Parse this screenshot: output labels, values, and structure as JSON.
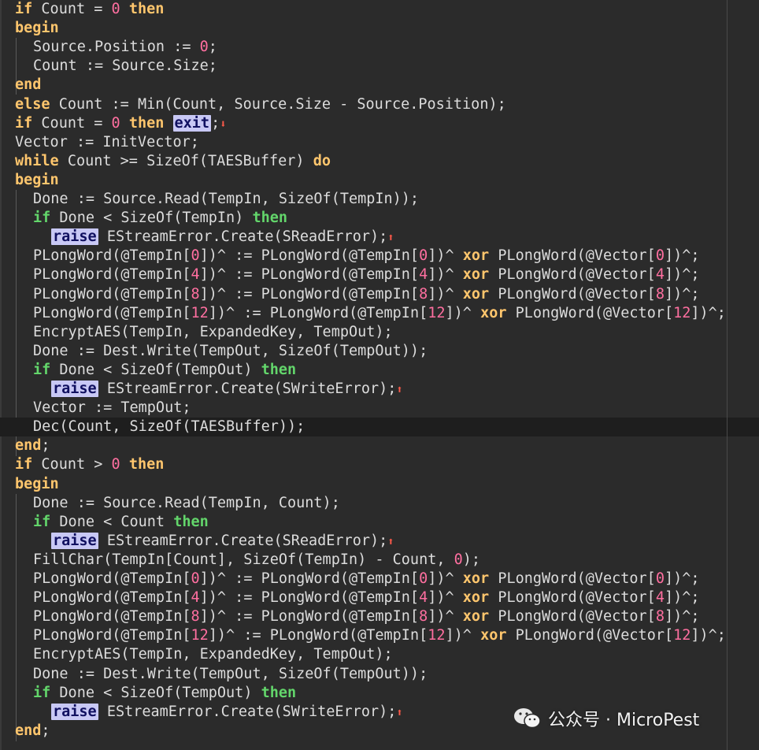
{
  "editor": {
    "current_line_index": 22,
    "lines": [
      {
        "indent": 0,
        "tokens": [
          {
            "t": "kw",
            "v": "if"
          },
          {
            "t": "p",
            "v": " Count = "
          },
          {
            "t": "num",
            "v": "0"
          },
          {
            "t": "p",
            "v": " "
          },
          {
            "t": "kw",
            "v": "then"
          }
        ]
      },
      {
        "indent": 0,
        "tokens": [
          {
            "t": "kw",
            "v": "begin"
          }
        ]
      },
      {
        "indent": 1,
        "tokens": [
          {
            "t": "p",
            "v": "Source.Position := "
          },
          {
            "t": "num",
            "v": "0"
          },
          {
            "t": "p",
            "v": ";"
          }
        ]
      },
      {
        "indent": 1,
        "tokens": [
          {
            "t": "p",
            "v": "Count := Source.Size;"
          }
        ]
      },
      {
        "indent": 0,
        "tokens": [
          {
            "t": "kw",
            "v": "end"
          }
        ]
      },
      {
        "indent": 0,
        "tokens": [
          {
            "t": "kw",
            "v": "else"
          },
          {
            "t": "p",
            "v": " Count := Min(Count, Source.Size - Source.Position);"
          }
        ]
      },
      {
        "indent": 0,
        "tokens": [
          {
            "t": "kw",
            "v": "if"
          },
          {
            "t": "p",
            "v": " Count = "
          },
          {
            "t": "num",
            "v": "0"
          },
          {
            "t": "p",
            "v": " "
          },
          {
            "t": "kw",
            "v": "then"
          },
          {
            "t": "p",
            "v": " "
          },
          {
            "t": "hl",
            "v": "exit"
          },
          {
            "t": "p",
            "v": ";"
          },
          {
            "t": "arrow",
            "v": "down"
          }
        ]
      },
      {
        "indent": 0,
        "tokens": [
          {
            "t": "p",
            "v": "Vector := InitVector;"
          }
        ]
      },
      {
        "indent": 0,
        "tokens": [
          {
            "t": "kw",
            "v": "while"
          },
          {
            "t": "p",
            "v": " Count >= SizeOf(TAESBuffer) "
          },
          {
            "t": "kw",
            "v": "do"
          }
        ]
      },
      {
        "indent": 0,
        "tokens": [
          {
            "t": "kw",
            "v": "begin"
          }
        ]
      },
      {
        "indent": 1,
        "tokens": [
          {
            "t": "p",
            "v": "Done := Source.Read(TempIn, SizeOf(TempIn));"
          }
        ]
      },
      {
        "indent": 1,
        "tokens": [
          {
            "t": "kwg",
            "v": "if"
          },
          {
            "t": "p",
            "v": " Done < SizeOf(TempIn) "
          },
          {
            "t": "kwg",
            "v": "then"
          }
        ]
      },
      {
        "indent": 2,
        "tokens": [
          {
            "t": "hl",
            "v": "raise"
          },
          {
            "t": "p",
            "v": " EStreamError.Create(SReadError);"
          },
          {
            "t": "arrow",
            "v": "up"
          }
        ]
      },
      {
        "indent": 1,
        "tokens": [
          {
            "t": "p",
            "v": "PLongWord(@TempIn["
          },
          {
            "t": "num",
            "v": "0"
          },
          {
            "t": "p",
            "v": "])^ := PLongWord(@TempIn["
          },
          {
            "t": "num",
            "v": "0"
          },
          {
            "t": "p",
            "v": "])^ "
          },
          {
            "t": "kw",
            "v": "xor"
          },
          {
            "t": "p",
            "v": " PLongWord(@Vector["
          },
          {
            "t": "num",
            "v": "0"
          },
          {
            "t": "p",
            "v": "])^;"
          }
        ]
      },
      {
        "indent": 1,
        "tokens": [
          {
            "t": "p",
            "v": "PLongWord(@TempIn["
          },
          {
            "t": "num",
            "v": "4"
          },
          {
            "t": "p",
            "v": "])^ := PLongWord(@TempIn["
          },
          {
            "t": "num",
            "v": "4"
          },
          {
            "t": "p",
            "v": "])^ "
          },
          {
            "t": "kw",
            "v": "xor"
          },
          {
            "t": "p",
            "v": " PLongWord(@Vector["
          },
          {
            "t": "num",
            "v": "4"
          },
          {
            "t": "p",
            "v": "])^;"
          }
        ]
      },
      {
        "indent": 1,
        "tokens": [
          {
            "t": "p",
            "v": "PLongWord(@TempIn["
          },
          {
            "t": "num",
            "v": "8"
          },
          {
            "t": "p",
            "v": "])^ := PLongWord(@TempIn["
          },
          {
            "t": "num",
            "v": "8"
          },
          {
            "t": "p",
            "v": "])^ "
          },
          {
            "t": "kw",
            "v": "xor"
          },
          {
            "t": "p",
            "v": " PLongWord(@Vector["
          },
          {
            "t": "num",
            "v": "8"
          },
          {
            "t": "p",
            "v": "])^;"
          }
        ]
      },
      {
        "indent": 1,
        "tokens": [
          {
            "t": "p",
            "v": "PLongWord(@TempIn["
          },
          {
            "t": "num",
            "v": "12"
          },
          {
            "t": "p",
            "v": "])^ := PLongWord(@TempIn["
          },
          {
            "t": "num",
            "v": "12"
          },
          {
            "t": "p",
            "v": "])^ "
          },
          {
            "t": "kw",
            "v": "xor"
          },
          {
            "t": "p",
            "v": " PLongWord(@Vector["
          },
          {
            "t": "num",
            "v": "12"
          },
          {
            "t": "p",
            "v": "])^;"
          }
        ]
      },
      {
        "indent": 1,
        "tokens": [
          {
            "t": "p",
            "v": "EncryptAES(TempIn, ExpandedKey, TempOut);"
          }
        ]
      },
      {
        "indent": 1,
        "tokens": [
          {
            "t": "p",
            "v": "Done := Dest.Write(TempOut, SizeOf(TempOut));"
          }
        ]
      },
      {
        "indent": 1,
        "tokens": [
          {
            "t": "kwg",
            "v": "if"
          },
          {
            "t": "p",
            "v": " Done < SizeOf(TempOut) "
          },
          {
            "t": "kwg",
            "v": "then"
          }
        ]
      },
      {
        "indent": 2,
        "tokens": [
          {
            "t": "hl",
            "v": "raise"
          },
          {
            "t": "p",
            "v": " EStreamError.Create(SWriteError);"
          },
          {
            "t": "arrow",
            "v": "up"
          }
        ]
      },
      {
        "indent": 1,
        "tokens": [
          {
            "t": "p",
            "v": "Vector := TempOut;"
          }
        ]
      },
      {
        "indent": 1,
        "tokens": [
          {
            "t": "p",
            "v": "Dec(Count, SizeOf(TAESBuffer));"
          }
        ]
      },
      {
        "indent": 0,
        "tokens": [
          {
            "t": "kw",
            "v": "end"
          },
          {
            "t": "p",
            "v": ";"
          }
        ]
      },
      {
        "indent": 0,
        "tokens": [
          {
            "t": "kw",
            "v": "if"
          },
          {
            "t": "p",
            "v": " Count > "
          },
          {
            "t": "num",
            "v": "0"
          },
          {
            "t": "p",
            "v": " "
          },
          {
            "t": "kw",
            "v": "then"
          }
        ]
      },
      {
        "indent": 0,
        "tokens": [
          {
            "t": "kw",
            "v": "begin"
          }
        ]
      },
      {
        "indent": 1,
        "tokens": [
          {
            "t": "p",
            "v": "Done := Source.Read(TempIn, Count);"
          }
        ]
      },
      {
        "indent": 1,
        "tokens": [
          {
            "t": "kwg",
            "v": "if"
          },
          {
            "t": "p",
            "v": " Done < Count "
          },
          {
            "t": "kwg",
            "v": "then"
          }
        ]
      },
      {
        "indent": 2,
        "tokens": [
          {
            "t": "hl",
            "v": "raise"
          },
          {
            "t": "p",
            "v": " EStreamError.Create(SReadError);"
          },
          {
            "t": "arrow",
            "v": "up"
          }
        ]
      },
      {
        "indent": 1,
        "tokens": [
          {
            "t": "p",
            "v": "FillChar(TempIn[Count], SizeOf(TempIn) - Count, "
          },
          {
            "t": "num",
            "v": "0"
          },
          {
            "t": "p",
            "v": ");"
          }
        ]
      },
      {
        "indent": 1,
        "tokens": [
          {
            "t": "p",
            "v": "PLongWord(@TempIn["
          },
          {
            "t": "num",
            "v": "0"
          },
          {
            "t": "p",
            "v": "])^ := PLongWord(@TempIn["
          },
          {
            "t": "num",
            "v": "0"
          },
          {
            "t": "p",
            "v": "])^ "
          },
          {
            "t": "kw",
            "v": "xor"
          },
          {
            "t": "p",
            "v": " PLongWord(@Vector["
          },
          {
            "t": "num",
            "v": "0"
          },
          {
            "t": "p",
            "v": "])^;"
          }
        ]
      },
      {
        "indent": 1,
        "tokens": [
          {
            "t": "p",
            "v": "PLongWord(@TempIn["
          },
          {
            "t": "num",
            "v": "4"
          },
          {
            "t": "p",
            "v": "])^ := PLongWord(@TempIn["
          },
          {
            "t": "num",
            "v": "4"
          },
          {
            "t": "p",
            "v": "])^ "
          },
          {
            "t": "kw",
            "v": "xor"
          },
          {
            "t": "p",
            "v": " PLongWord(@Vector["
          },
          {
            "t": "num",
            "v": "4"
          },
          {
            "t": "p",
            "v": "])^;"
          }
        ]
      },
      {
        "indent": 1,
        "tokens": [
          {
            "t": "p",
            "v": "PLongWord(@TempIn["
          },
          {
            "t": "num",
            "v": "8"
          },
          {
            "t": "p",
            "v": "])^ := PLongWord(@TempIn["
          },
          {
            "t": "num",
            "v": "8"
          },
          {
            "t": "p",
            "v": "])^ "
          },
          {
            "t": "kw",
            "v": "xor"
          },
          {
            "t": "p",
            "v": " PLongWord(@Vector["
          },
          {
            "t": "num",
            "v": "8"
          },
          {
            "t": "p",
            "v": "])^;"
          }
        ]
      },
      {
        "indent": 1,
        "tokens": [
          {
            "t": "p",
            "v": "PLongWord(@TempIn["
          },
          {
            "t": "num",
            "v": "12"
          },
          {
            "t": "p",
            "v": "])^ := PLongWord(@TempIn["
          },
          {
            "t": "num",
            "v": "12"
          },
          {
            "t": "p",
            "v": "])^ "
          },
          {
            "t": "kw",
            "v": "xor"
          },
          {
            "t": "p",
            "v": " PLongWord(@Vector["
          },
          {
            "t": "num",
            "v": "12"
          },
          {
            "t": "p",
            "v": "])^;"
          }
        ]
      },
      {
        "indent": 1,
        "tokens": [
          {
            "t": "p",
            "v": "EncryptAES(TempIn, ExpandedKey, TempOut);"
          }
        ]
      },
      {
        "indent": 1,
        "tokens": [
          {
            "t": "p",
            "v": "Done := Dest.Write(TempOut, SizeOf(TempOut));"
          }
        ]
      },
      {
        "indent": 1,
        "tokens": [
          {
            "t": "kwg",
            "v": "if"
          },
          {
            "t": "p",
            "v": " Done < SizeOf(TempOut) "
          },
          {
            "t": "kwg",
            "v": "then"
          }
        ]
      },
      {
        "indent": 2,
        "tokens": [
          {
            "t": "hl",
            "v": "raise"
          },
          {
            "t": "p",
            "v": " EStreamError.Create(SWriteError);"
          },
          {
            "t": "arrow",
            "v": "up"
          }
        ]
      },
      {
        "indent": 0,
        "tokens": [
          {
            "t": "kw",
            "v": "end"
          },
          {
            "t": "p",
            "v": ";"
          }
        ]
      }
    ]
  },
  "watermark": {
    "text": "公众号 · MicroPest",
    "icon": "wechat-icon"
  },
  "colors": {
    "background": "#2b2b2b",
    "current_line": "#1e1e1e",
    "keyword": "#ffc66d",
    "keyword_green": "#63d66b",
    "number": "#ff6fa0",
    "highlight": "#c8c8f5",
    "arrow": "#ff5a4a",
    "text": "#dcdcdc"
  }
}
